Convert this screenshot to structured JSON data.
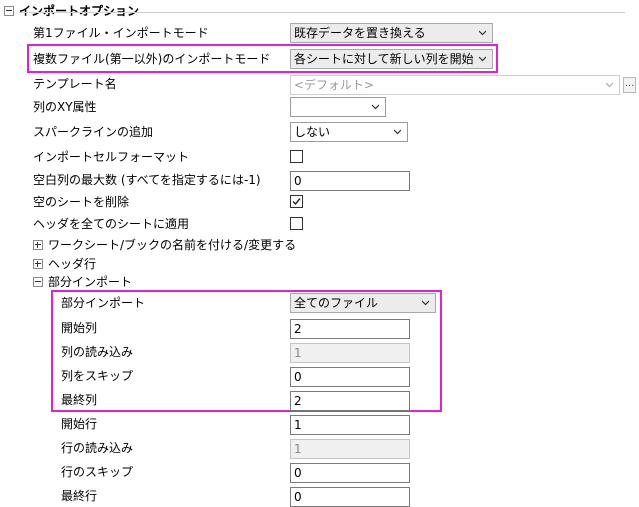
{
  "section": {
    "title": "インポートオプション"
  },
  "rows": {
    "first_mode": {
      "label": "第1ファイル・インポートモード",
      "value": "既存データを置き換える"
    },
    "multi_mode": {
      "label": "複数ファイル(第一以外)のインポートモード",
      "value": "各シートに対して新しい列を開始"
    },
    "template": {
      "label": "テンプレート名",
      "value": "<デフォルト>",
      "button": "..."
    },
    "xy_attr": {
      "label": "列のXY属性",
      "value": ""
    },
    "sparkline": {
      "label": "スパークラインの追加",
      "value": "しない"
    },
    "cell_format": {
      "label": "インポートセルフォーマット",
      "checked": false
    },
    "max_blank": {
      "label": "空白列の最大数 (すべてを指定するには-1)",
      "value": "0"
    },
    "delete_empty": {
      "label": "空のシートを削除",
      "checked": true
    },
    "apply_header": {
      "label": "ヘッダを全てのシートに適用",
      "checked": false
    }
  },
  "groups": {
    "rename": {
      "label": "ワークシート/ブックの名前を付ける/変更する"
    },
    "header_lines": {
      "label": "ヘッダ行"
    },
    "partial": {
      "label": "部分インポート"
    }
  },
  "partial": {
    "mode": {
      "label": "部分インポート",
      "value": "全てのファイル"
    },
    "start_col": {
      "label": "開始列",
      "value": "2"
    },
    "read_cols": {
      "label": "列の読み込み",
      "value": "1"
    },
    "skip_cols": {
      "label": "列をスキップ",
      "value": "0"
    },
    "end_col": {
      "label": "最終列",
      "value": "2"
    },
    "start_row": {
      "label": "開始行",
      "value": "1"
    },
    "read_rows": {
      "label": "行の読み込み",
      "value": "1"
    },
    "skip_rows": {
      "label": "行のスキップ",
      "value": "0"
    },
    "end_row": {
      "label": "最終行",
      "value": "0"
    }
  },
  "colors": {
    "highlight": "#e61ed2"
  },
  "icons": {
    "collapse": "minus-box-icon",
    "expand": "plus-box-icon",
    "dropdown": "chevron-down-icon",
    "check": "check-icon"
  }
}
